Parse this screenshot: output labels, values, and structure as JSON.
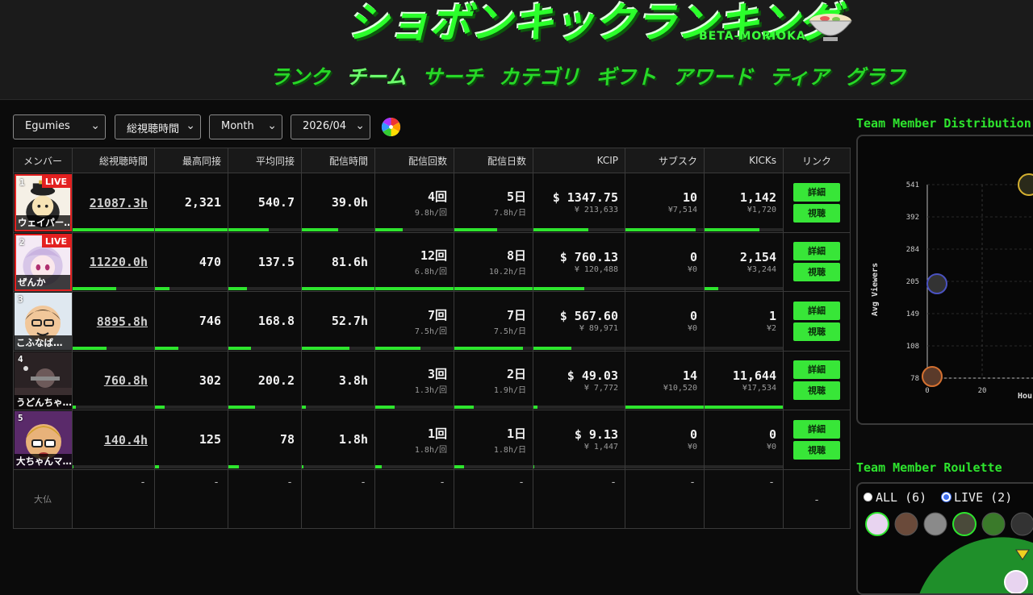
{
  "header": {
    "logo_text": "ショボンキックランキング",
    "logo_sub": "BETA-MORIOKA",
    "nav": [
      "ランク",
      "チーム",
      "サーチ",
      "カテゴリ",
      "ギフト",
      "アワード",
      "ティア",
      "グラフ"
    ],
    "nav_active": "チーム"
  },
  "filters": {
    "team": "Egumies",
    "metric": "総視聴時間",
    "range": "Month",
    "month": "2026/04"
  },
  "table": {
    "headers": [
      "メンバー",
      "総視聴時間",
      "最高同接",
      "平均同接",
      "配信時間",
      "配信回数",
      "配信日数",
      "KCIP",
      "サブスク",
      "KICKs",
      "リンク"
    ],
    "rows": [
      {
        "rank": "1",
        "live": "LIVE",
        "name": "ウェイパー…",
        "total_hours": "21087.3h",
        "peak": "2,321",
        "avg": "540.7",
        "stream_time": "39.0h",
        "count": "4回",
        "count_sub": "9.8h/回",
        "days": "5日",
        "days_sub": "7.8h/日",
        "kcip": "$ 1347.75",
        "kcip_sub": "¥ 213,633",
        "subs": "10",
        "subs_sub": "¥7,514",
        "kicks": "1,142",
        "kicks_sub": "¥1,720",
        "bars": [
          1,
          1,
          0.55,
          0.5,
          0.35,
          0.55,
          0.6,
          0.9,
          0.7,
          0.3
        ]
      },
      {
        "rank": "2",
        "live": "LIVE",
        "name": "ぜんか",
        "total_hours": "11220.0h",
        "peak": "470",
        "avg": "137.5",
        "stream_time": "81.6h",
        "count": "12回",
        "count_sub": "6.8h/回",
        "days": "8日",
        "days_sub": "10.2h/日",
        "kcip": "$ 760.13",
        "kcip_sub": "¥ 120,488",
        "subs": "0",
        "subs_sub": "¥0",
        "kicks": "2,154",
        "kicks_sub": "¥3,244",
        "bars": [
          0.53,
          0.2,
          0.25,
          1,
          1,
          1,
          0.56,
          0,
          0.18,
          0.15
        ]
      },
      {
        "rank": "3",
        "live": "",
        "name": "こふなば…",
        "total_hours": "8895.8h",
        "peak": "746",
        "avg": "168.8",
        "stream_time": "52.7h",
        "count": "7回",
        "count_sub": "7.5h/回",
        "days": "7日",
        "days_sub": "7.5h/日",
        "kcip": "$ 567.60",
        "kcip_sub": "¥ 89,971",
        "subs": "0",
        "subs_sub": "¥0",
        "kicks": "1",
        "kicks_sub": "¥2",
        "bars": [
          0.42,
          0.32,
          0.31,
          0.65,
          0.58,
          0.88,
          0.42,
          0,
          0,
          0
        ]
      },
      {
        "rank": "4",
        "live": "",
        "name": "うどんちゃ…",
        "total_hours": "760.8h",
        "peak": "302",
        "avg": "200.2",
        "stream_time": "3.8h",
        "count": "3回",
        "count_sub": "1.3h/回",
        "days": "2日",
        "days_sub": "1.9h/日",
        "kcip": "$ 49.03",
        "kcip_sub": "¥ 7,772",
        "subs": "14",
        "subs_sub": "¥10,520",
        "kicks": "11,644",
        "kicks_sub": "¥17,534",
        "bars": [
          0.04,
          0.13,
          0.37,
          0.05,
          0.25,
          0.25,
          0.04,
          1,
          1,
          1
        ]
      },
      {
        "rank": "5",
        "live": "",
        "name": "大ちゃんマ…",
        "total_hours": "140.4h",
        "peak": "125",
        "avg": "78",
        "stream_time": "1.8h",
        "count": "1回",
        "count_sub": "1.8h/回",
        "days": "1日",
        "days_sub": "1.8h/日",
        "kcip": "$ 9.13",
        "kcip_sub": "¥ 1,447",
        "subs": "0",
        "subs_sub": "¥0",
        "kicks": "0",
        "kicks_sub": "¥0",
        "bars": [
          0.01,
          0.05,
          0.14,
          0.02,
          0.08,
          0.12,
          0.01,
          0,
          0,
          0
        ]
      }
    ],
    "empty_row": {
      "name": "大仏",
      "dash": "-"
    },
    "btn_detail": "詳細",
    "btn_watch": "視聴"
  },
  "distribution": {
    "title": "Team Member Distribution",
    "ylabel": "Avg Viewers",
    "xlabel": "Hours",
    "yticks": [
      "541",
      "392",
      "284",
      "205",
      "149",
      "108",
      "78"
    ],
    "xticks": [
      "0",
      "20"
    ]
  },
  "roulette": {
    "title": "Team Member Roulette",
    "all_label": "ALL (6)",
    "live_label": "LIVE (2)",
    "selected": "LIVE"
  },
  "colors": {
    "accent": "#2ee52e",
    "live": "#e32020",
    "button": "#38e638"
  }
}
